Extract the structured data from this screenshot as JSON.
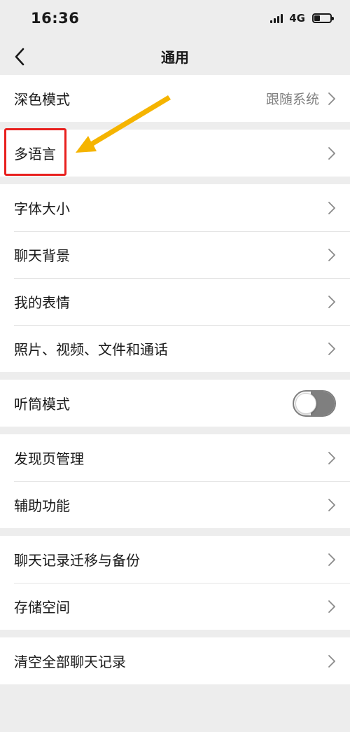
{
  "status_bar": {
    "time": "16:36",
    "network": "4G"
  },
  "nav": {
    "title": "通用"
  },
  "groups": [
    [
      {
        "label": "深色模式",
        "value": "跟随系统"
      }
    ],
    [
      {
        "label": "多语言"
      }
    ],
    [
      {
        "label": "字体大小"
      },
      {
        "label": "聊天背景"
      },
      {
        "label": "我的表情"
      },
      {
        "label": "照片、视频、文件和通话"
      }
    ],
    [
      {
        "label": "听筒模式",
        "toggle": false
      }
    ],
    [
      {
        "label": "发现页管理"
      },
      {
        "label": "辅助功能"
      }
    ],
    [
      {
        "label": "聊天记录迁移与备份"
      },
      {
        "label": "存储空间"
      }
    ],
    [
      {
        "label": "清空全部聊天记录"
      }
    ]
  ],
  "colors": {
    "background": "#ededed",
    "annotation_box": "#e8201e",
    "annotation_arrow": "#f5b400"
  }
}
